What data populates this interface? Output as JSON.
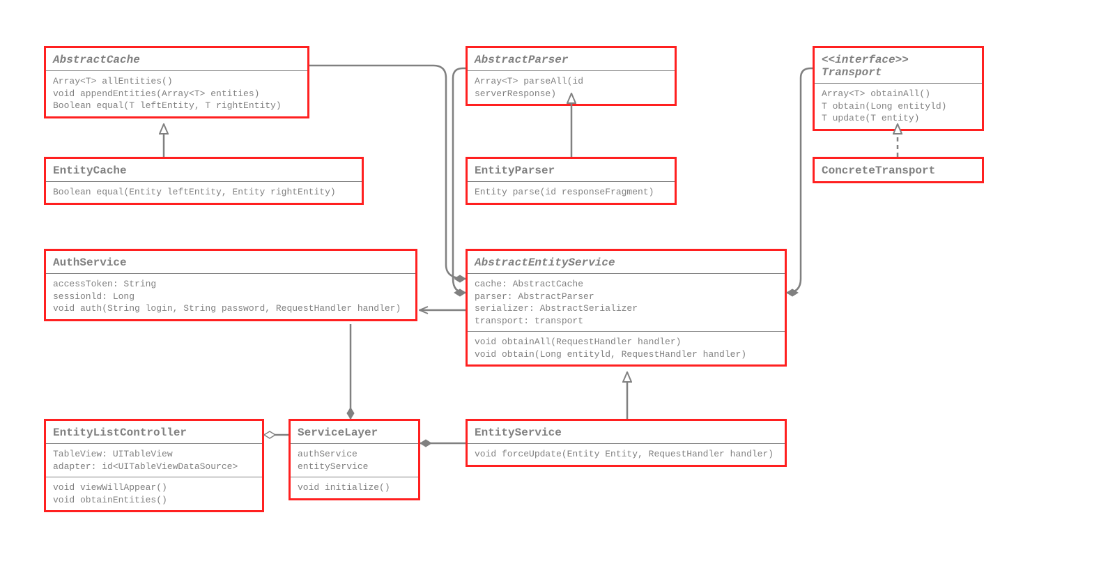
{
  "classes": {
    "abstractCache": {
      "title": "AbstractCache",
      "m0": "Array<T> allEntities()",
      "m1": "void appendEntities(Array<T> entities)",
      "m2": "Boolean equal(T leftEntity, T rightEntity)"
    },
    "entityCache": {
      "title": "EntityCache",
      "m0": "Boolean equal(Entity leftEntity, Entity rightEntity)"
    },
    "abstractParser": {
      "title": "AbstractParser",
      "m0": "Array<T> parseAll(id serverResponse)"
    },
    "entityParser": {
      "title": "EntityParser",
      "m0": "Entity parse(id responseFragment)"
    },
    "transport": {
      "title": "<<interface>> Transport",
      "m0": "Array<T> obtainAll()",
      "m1": "T obtain(Long entityld)",
      "m2": "T update(T entity)"
    },
    "concreteTransport": {
      "title": "ConcreteTransport"
    },
    "authService": {
      "title": "AuthService",
      "a0": "accessToken: String",
      "a1": "sessionld: Long",
      "a2": "void auth(String login, String password, RequestHandler handler)"
    },
    "abstractEntityService": {
      "title": "AbstractEntityService",
      "a0": "cache: AbstractCache",
      "a1": "parser: AbstractParser",
      "a2": "serializer: AbstractSerializer",
      "a3": "transport: transport",
      "m0": "void obtainAll(RequestHandler handler)",
      "m1": "void obtain(Long entityld, RequestHandler handler)"
    },
    "entityService": {
      "title": "EntityService",
      "m0": "void forceUpdate(Entity Entity, RequestHandler handler)"
    },
    "serviceLayer": {
      "title": "ServiceLayer",
      "a0": "authService",
      "a1": "entityService",
      "m0": "void initialize()"
    },
    "entityListController": {
      "title": "EntityListController",
      "a0": "TableView: UITableView",
      "a1": "adapter: id<UITableViewDataSource>",
      "m0": "void viewWillAppear()",
      "m1": "void obtainEntities()"
    }
  },
  "relations": [
    {
      "from": "EntityCache",
      "to": "AbstractCache",
      "type": "inheritance"
    },
    {
      "from": "EntityParser",
      "to": "AbstractParser",
      "type": "inheritance"
    },
    {
      "from": "ConcreteTransport",
      "to": "Transport",
      "type": "realization"
    },
    {
      "from": "EntityService",
      "to": "AbstractEntityService",
      "type": "inheritance"
    },
    {
      "from": "AbstractEntityService",
      "to": "AbstractCache",
      "type": "composition"
    },
    {
      "from": "AbstractEntityService",
      "to": "AbstractParser",
      "type": "composition"
    },
    {
      "from": "AbstractEntityService",
      "to": "Transport",
      "type": "composition"
    },
    {
      "from": "AbstractEntityService",
      "to": "AuthService",
      "type": "dependency"
    },
    {
      "from": "ServiceLayer",
      "to": "AuthService",
      "type": "composition"
    },
    {
      "from": "ServiceLayer",
      "to": "EntityService",
      "type": "composition"
    },
    {
      "from": "EntityListController",
      "to": "ServiceLayer",
      "type": "aggregation"
    }
  ]
}
